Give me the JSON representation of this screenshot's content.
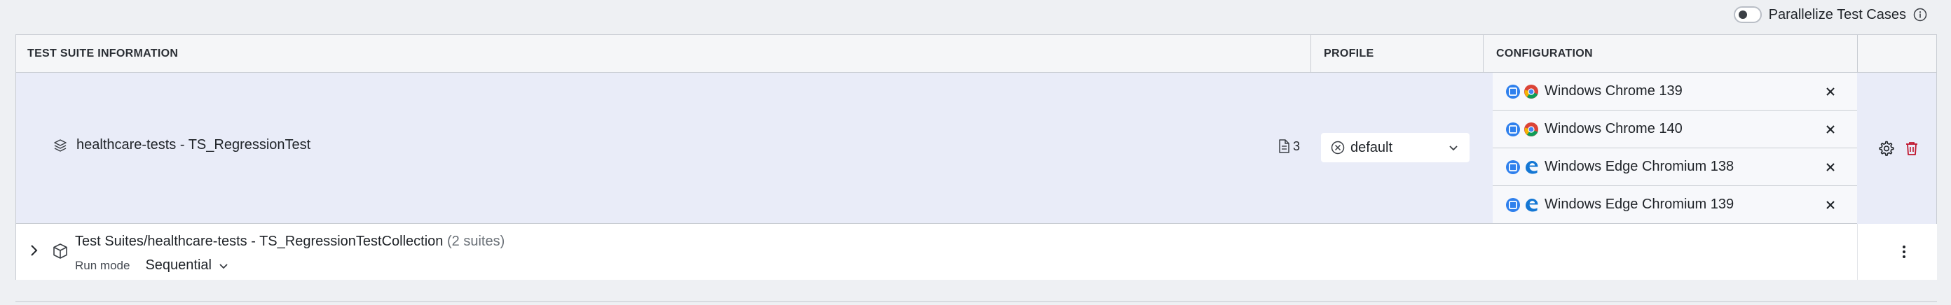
{
  "toolbar": {
    "parallelize_label": "Parallelize Test Cases",
    "parallelize_enabled": false
  },
  "table": {
    "headers": {
      "suite_info": "TEST SUITE INFORMATION",
      "profile": "PROFILE",
      "configuration": "CONFIGURATION"
    }
  },
  "suite": {
    "name": "healthcare-tests - TS_RegressionTest",
    "test_case_count": "3",
    "profile": "default",
    "configurations": [
      {
        "os": "windows-icon",
        "browser": "chrome-icon",
        "label": "Windows Chrome 139"
      },
      {
        "os": "windows-icon",
        "browser": "chrome-icon",
        "label": "Windows Chrome 140"
      },
      {
        "os": "windows-icon",
        "browser": "edge-icon",
        "label": "Windows Edge Chromium 138"
      },
      {
        "os": "windows-icon",
        "browser": "edge-icon",
        "label": "Windows Edge Chromium 139"
      }
    ]
  },
  "collection": {
    "title": "Test Suites/healthcare-tests - TS_RegressionTestCollection",
    "count": "(2 suites)",
    "run_mode_label": "Run mode",
    "run_mode_value": "Sequential"
  },
  "colors": {
    "accent_blue": "#2f6fdb",
    "delete_red": "#c0152d",
    "row_highlight": "#e9ecf8"
  }
}
